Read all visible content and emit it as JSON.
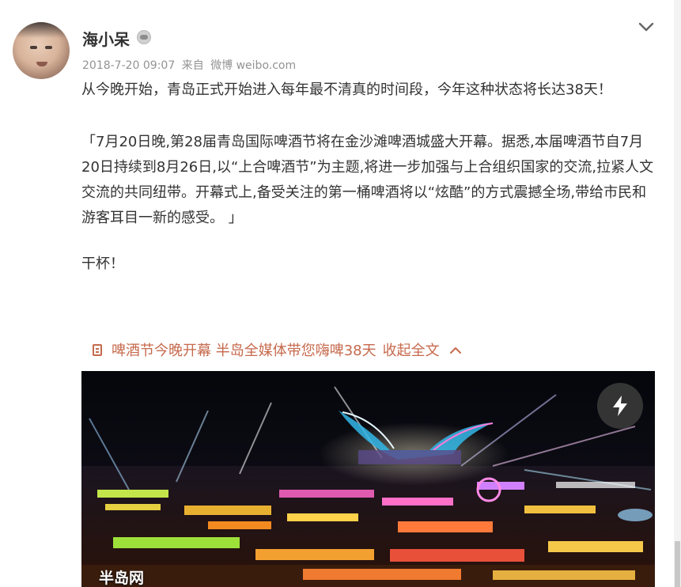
{
  "post": {
    "author": "海小呆",
    "time": "2018-7-20 09:07",
    "source_prefix": "来自",
    "source": "微博 weibo.com",
    "paragraphs": [
      "从今晚开始，青岛正式开始进入每年最不清真的时间段，今年这种状态将长达38天！",
      "「7月20日晚,第28届青岛国际啤酒节将在金沙滩啤酒城盛大开幕。据悉,本届啤酒节自7月20日持续到8月26日,以“上合啤酒节”为主题,将进一步加强与上合组织国家的交流,拉紧人文交流的共同纽带。开幕式上,备受关注的第一桶啤酒将以“炫酷”的方式震撼全场,带给市民和游客耳目一新的感受。 」",
      "干杯！"
    ]
  },
  "article": {
    "title": "啤酒节今晚开幕 半岛全媒体带您嗨啤38天",
    "collapse_label": "收起全文"
  },
  "media": {
    "watermark": "半岛网"
  },
  "icons": {
    "menu": "chevron-down-icon",
    "vip": "vip-badge-icon",
    "article": "document-icon",
    "collapse": "chevron-up-icon",
    "flash": "lightning-icon"
  },
  "colors": {
    "link": "#c66a4d",
    "meta": "#939393",
    "text": "#333333"
  }
}
